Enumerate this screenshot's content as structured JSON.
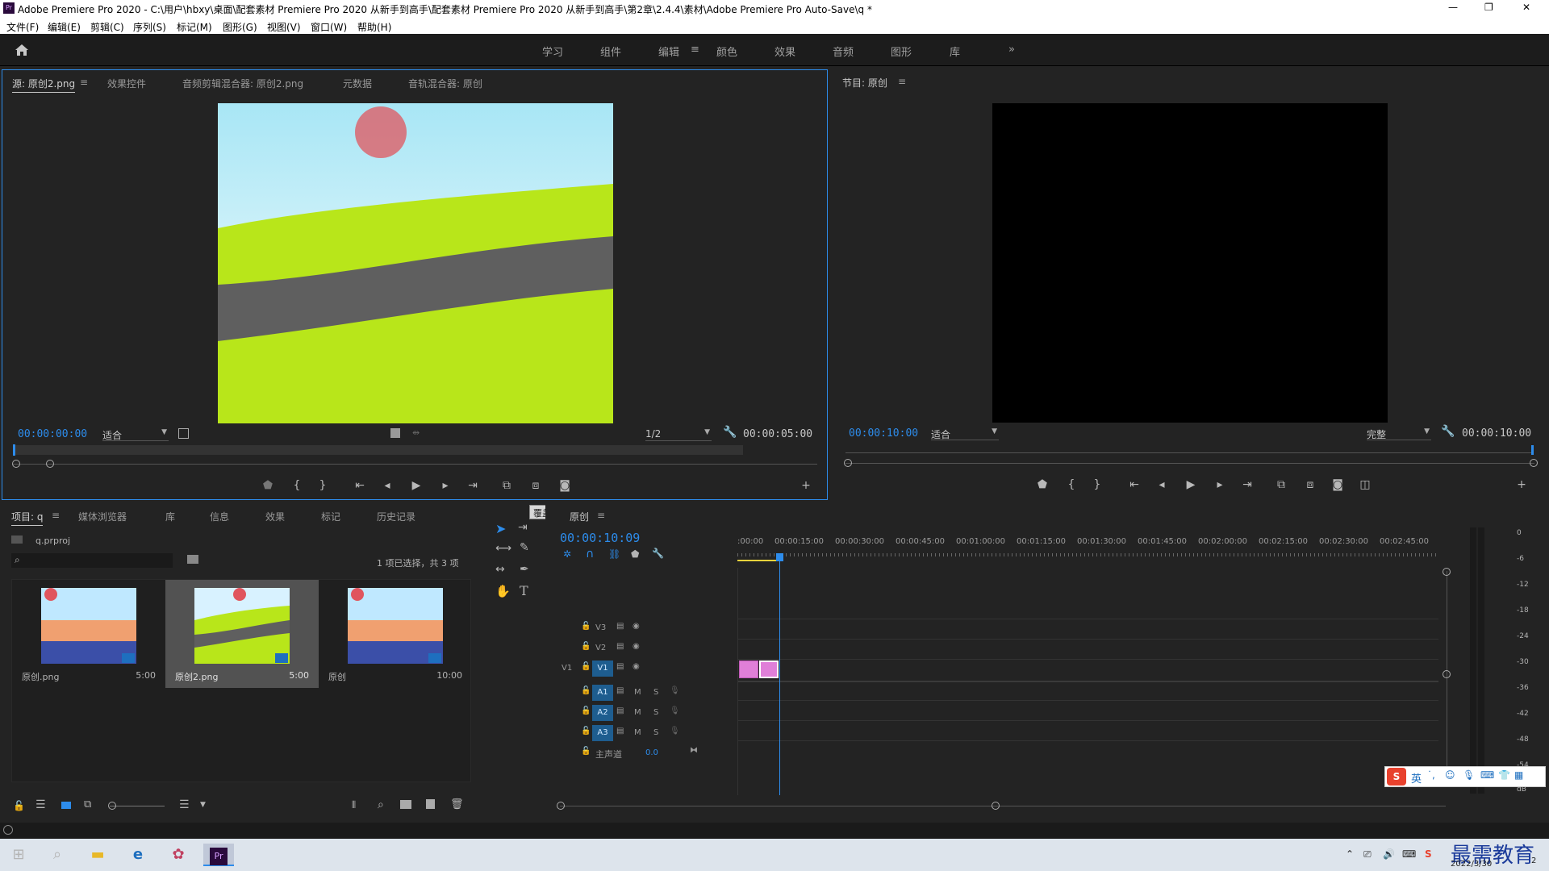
{
  "window": {
    "title": "Adobe Premiere Pro 2020 - C:\\用户\\hbxy\\桌面\\配套素材 Premiere Pro 2020 从新手到高手\\配套素材 Premiere Pro 2020 从新手到高手\\第2章\\2.4.4\\素材\\Adobe Premiere Pro Auto-Save\\q *",
    "minimize": "—",
    "restore": "❐",
    "close": "✕",
    "app_icon": "Pr"
  },
  "menu": [
    "文件(F)",
    "编辑(E)",
    "剪辑(C)",
    "序列(S)",
    "标记(M)",
    "图形(G)",
    "视图(V)",
    "窗口(W)",
    "帮助(H)"
  ],
  "workspaces": {
    "items": [
      "学习",
      "组件",
      "编辑",
      "颜色",
      "效果",
      "音频",
      "图形",
      "库"
    ],
    "active": "编辑",
    "menu_glyph": "≡",
    "more": "»",
    "home_icon": "home-icon"
  },
  "source_panel": {
    "tabs": [
      "源: 原创2.png",
      "效果控件",
      "音频剪辑混合器: 原创2.png",
      "元数据",
      "音轨混合器: 原创"
    ],
    "menu_glyph": "≡",
    "timecode": "00:00:00:00",
    "fit": "适合",
    "resolution": "1/2",
    "duration": "00:00:05:00"
  },
  "program_panel": {
    "title": "节目: 原创",
    "menu_glyph": "≡",
    "timecode": "00:00:10:00",
    "fit": "适合",
    "quality": "完整",
    "duration": "00:00:10:00"
  },
  "tooltip": "覆盖 (.)",
  "project_panel": {
    "tabs": [
      "项目: q",
      "媒体浏览器",
      "库",
      "信息",
      "效果",
      "标记",
      "历史记录"
    ],
    "menu_glyph": "≡",
    "file": "q.prproj",
    "selection": "1 项已选择，共 3 项",
    "search_placeholder": "",
    "items": [
      {
        "name": "原创.png",
        "duration": "5:00",
        "selected": false
      },
      {
        "name": "原创2.png",
        "duration": "5:00",
        "selected": true
      },
      {
        "name": "原创",
        "duration": "10:00",
        "selected": false
      }
    ]
  },
  "timeline": {
    "sequence": "原创",
    "menu_glyph": "≡",
    "timecode": "00:00:10:09",
    "ruler": [
      ":00:00",
      "00:00:15:00",
      "00:00:30:00",
      "00:00:45:00",
      "00:01:00:00",
      "00:01:15:00",
      "00:01:30:00",
      "00:01:45:00",
      "00:02:00:00",
      "00:02:15:00",
      "00:02:30:00",
      "00:02:45:00"
    ],
    "video_tracks": [
      "V3",
      "V2",
      "V1"
    ],
    "audio_tracks": [
      "A1",
      "A2",
      "A3"
    ],
    "source_patch": "V1",
    "mute": "M",
    "solo": "S",
    "master": {
      "label": "主声道",
      "value": "0.0"
    }
  },
  "meter": {
    "scale": [
      "0",
      "-6",
      "-12",
      "-18",
      "-24",
      "-30",
      "-36",
      "-42",
      "-48",
      "-54",
      "dB"
    ]
  },
  "ime": {
    "label": "英"
  },
  "taskbar": {
    "time": "2022/3/30",
    "notification": "2",
    "watermark": "最需教育"
  }
}
